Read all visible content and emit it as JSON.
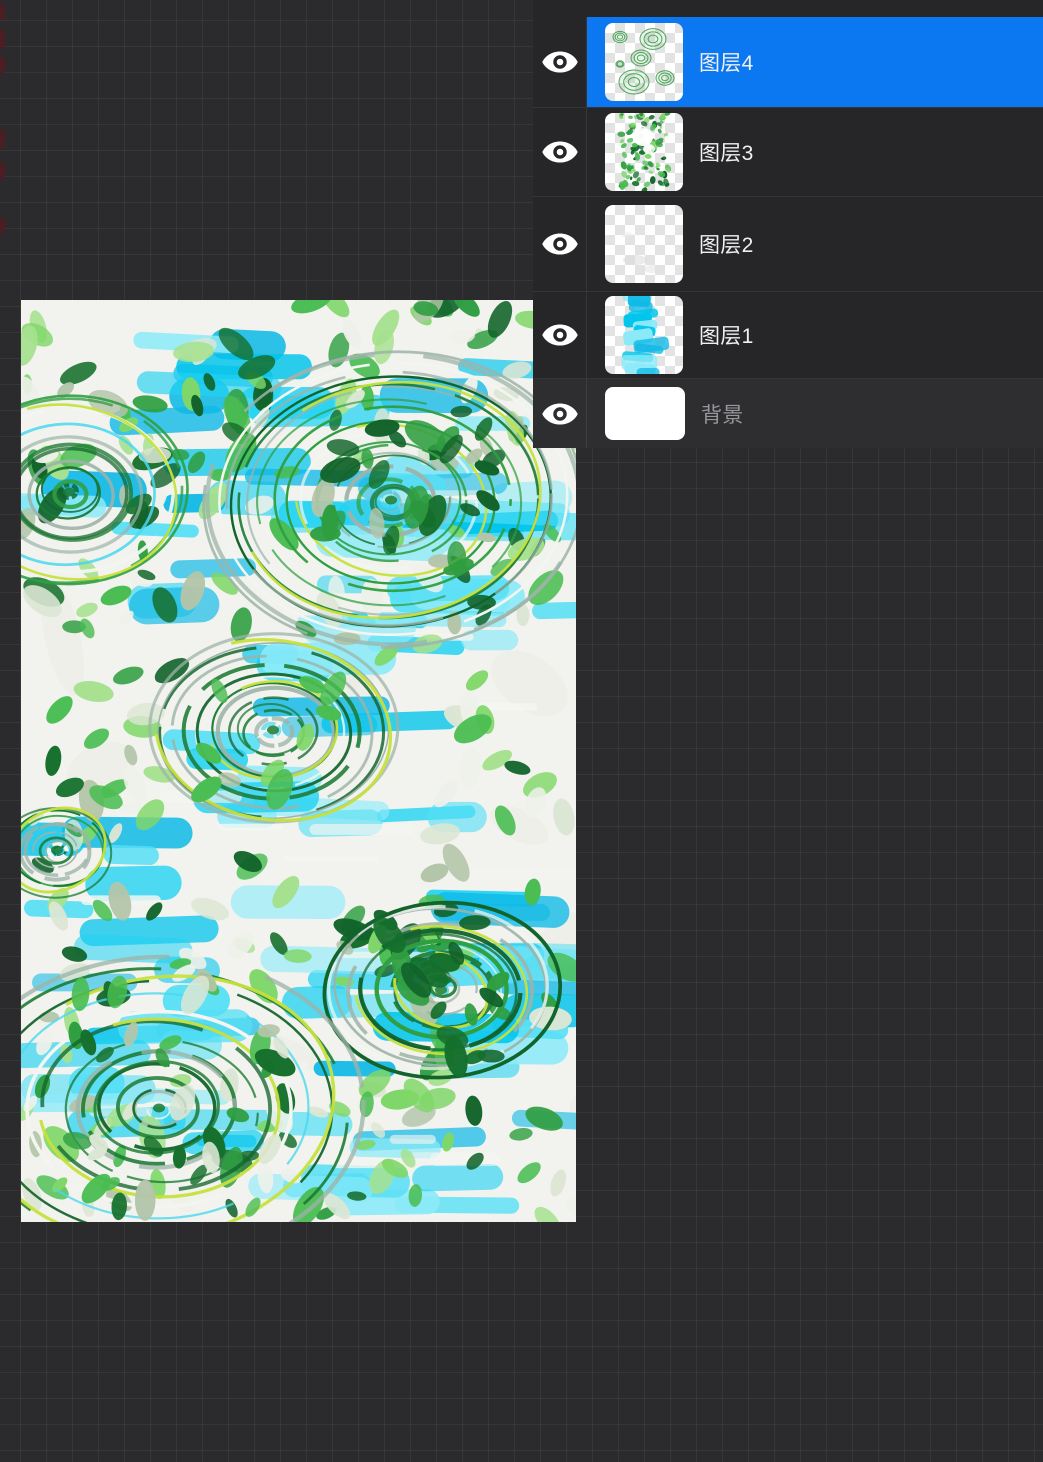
{
  "page": {
    "background_color": "#2b2a2c",
    "grid_line_color": "rgba(255,255,255,0.05)",
    "grid_size_px": 26
  },
  "layers_panel": {
    "selected_index": 0,
    "rows": [
      {
        "label": "图层4",
        "selected": true,
        "visible": true,
        "thumbnail": "green-ripple-sketch-on-transparent"
      },
      {
        "label": "图层3",
        "selected": false,
        "visible": true,
        "thumbnail": "green-leaves-strip-on-transparent"
      },
      {
        "label": "图层2",
        "selected": false,
        "visible": true,
        "thumbnail": "mostly-empty-transparent"
      },
      {
        "label": "图层1",
        "selected": false,
        "visible": true,
        "thumbnail": "cyan-paint-strip-on-transparent"
      },
      {
        "label": "背景",
        "selected": false,
        "visible": true,
        "thumbnail": "solid-white",
        "dimmed": true
      }
    ],
    "colors": {
      "selected_row": "#0b78f2",
      "panel_bg": "#262528",
      "background_row_bg": "#2e2d30",
      "label": "#f0f0f0",
      "dimmed_label": "#97979b",
      "divider": "rgba(255,255,255,0.08)"
    }
  },
  "canvas": {
    "description": "Digital watercolor painting: concentric rain ripples over cyan water with scattered green leaves on white paper",
    "palette": {
      "paper": "#f2f3ee",
      "cyans": [
        "#22d2f2",
        "#00c4ec",
        "#55dff5",
        "#8ceaf8",
        "#0fb9e6"
      ],
      "leaf_greens": [
        "#11632a",
        "#156f2c",
        "#2f9e41",
        "#4abd52",
        "#7fd768",
        "#a6e18f",
        "#b3c5a9",
        "#dce6d4",
        "#eef1ea"
      ],
      "ring_greens": [
        "#11632a",
        "#1b7a33",
        "#2f9e41"
      ],
      "ring_gray": "#9db3a8",
      "ring_white": "#f2f5f0",
      "ring_yellow_green": "#c6e03e",
      "ring_cyan": "#49d7ef"
    }
  }
}
